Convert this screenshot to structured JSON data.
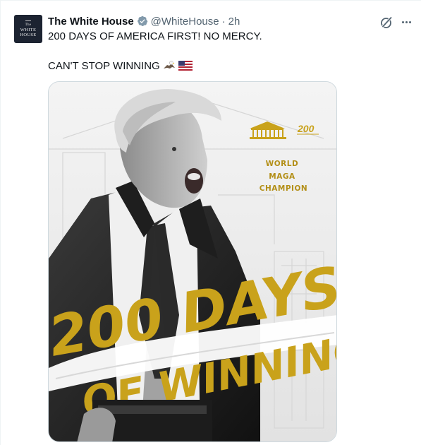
{
  "author": {
    "name": "The White House",
    "handle": "@WhiteHouse",
    "separator": "·",
    "timestamp": "2h",
    "avatar_text": [
      "The",
      "WHITE",
      "HOUSE"
    ],
    "verified_color": "#829aab"
  },
  "tweet": {
    "line1": "200 DAYS OF AMERICA FIRST! NO MERCY.",
    "line2": "CAN'T STOP WINNING",
    "emojis": [
      "eagle-emoji",
      "us-flag-emoji"
    ]
  },
  "media": {
    "badge_number": "200",
    "subtitle_lines": [
      "WORLD",
      "MAGA",
      "CHAMPION"
    ],
    "headline_top": "200 DAYS",
    "headline_bottom": "OF WINNING",
    "gold_color": "#c9a21b"
  },
  "icons": {
    "grok": "grok-icon",
    "more": "more-icon"
  }
}
